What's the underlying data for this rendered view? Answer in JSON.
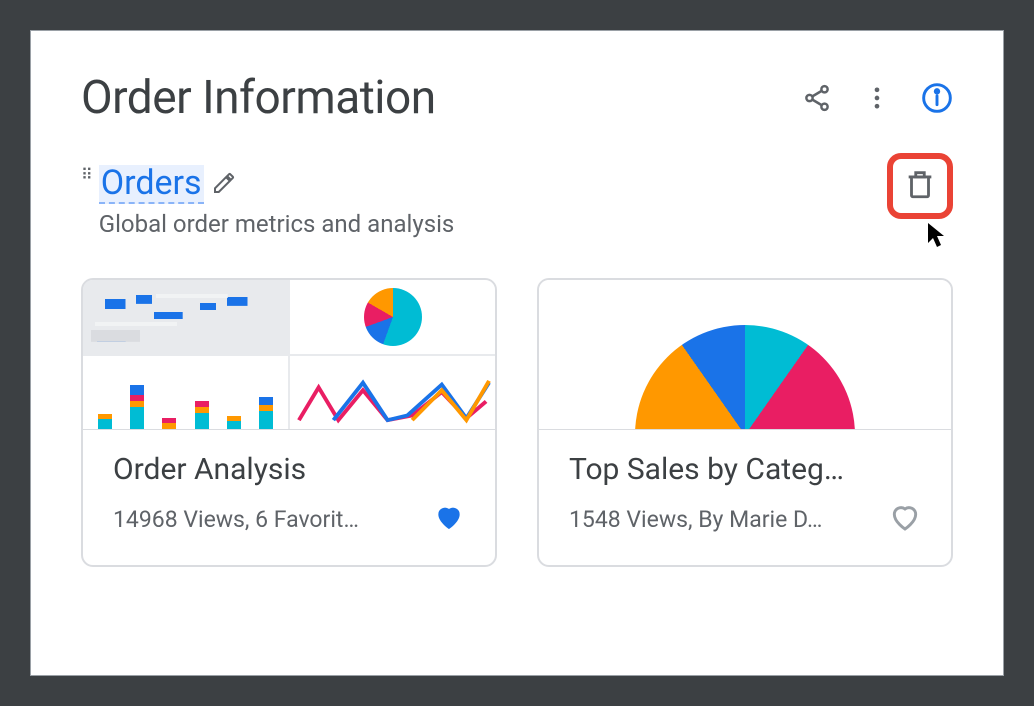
{
  "header": {
    "title": "Order Information"
  },
  "section": {
    "title": "Orders",
    "subtitle": "Global order metrics and analysis"
  },
  "cards": [
    {
      "title": "Order Analysis",
      "meta": "14968 Views, 6 Favorit…",
      "favorited": true
    },
    {
      "title": "Top Sales by Categ…",
      "meta": "1548 Views, By Marie D…",
      "favorited": false
    }
  ],
  "icons": {
    "share": "share-icon",
    "more": "more-vert-icon",
    "info": "info-icon",
    "drag": "drag-handle-icon",
    "edit": "edit-pencil-icon",
    "delete": "trash-icon",
    "cursor": "mouse-cursor-icon",
    "heart_filled": "heart-filled-icon",
    "heart_outline": "heart-outline-icon"
  },
  "colors": {
    "accent": "#1a73e8",
    "danger": "#ea4335",
    "text": "#3c4043",
    "muted": "#5f6368",
    "teal": "#00bcd4",
    "orange": "#ff9800",
    "magenta": "#e91e63"
  }
}
